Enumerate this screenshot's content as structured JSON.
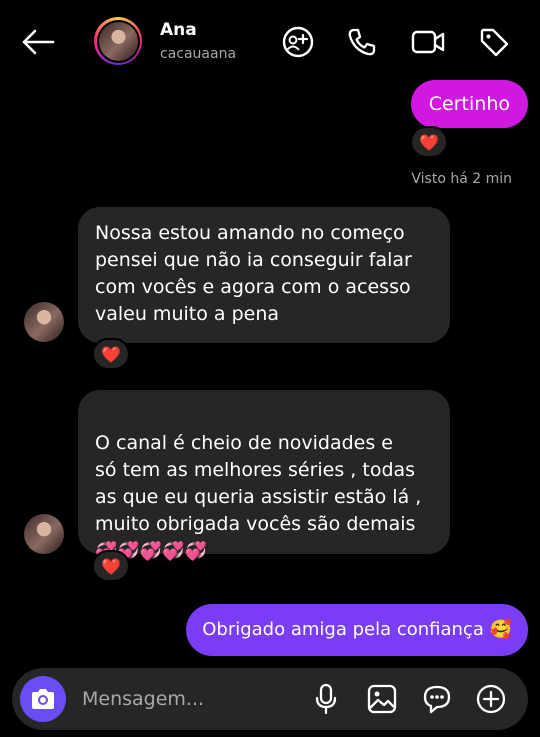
{
  "header": {
    "name": "Ana",
    "username": "cacauaana",
    "icons": [
      "back-arrow-icon",
      "add-people-icon",
      "phone-icon",
      "video-call-icon",
      "tag-icon"
    ]
  },
  "messages": [
    {
      "direction": "outgoing",
      "text": "Certinho",
      "reaction": "❤️"
    },
    {
      "direction": "incoming",
      "text": "Nossa estou amando no começo\npensei que não ia conseguir falar\ncom vocês e agora com o acesso\nvaleu muito a pena",
      "reaction": "❤️"
    },
    {
      "direction": "incoming",
      "text": "O canal é cheio de novidades e\nsó tem as melhores séries  , todas\nas que eu queria assistir estão lá ,\nmuito obrigada vocês são demais",
      "emoji_line": "💞💞💞💞💞",
      "reaction": "❤️"
    },
    {
      "direction": "outgoing",
      "text": "Obrigado amiga pela confiança 🥰"
    }
  ],
  "seen_label": "Visto há 2 min",
  "composer": {
    "placeholder": "Mensagem...",
    "icons": [
      "camera-icon",
      "microphone-icon",
      "gallery-icon",
      "sticker-icon",
      "plus-icon"
    ]
  },
  "colors": {
    "outgoing_pink": "#d118e0",
    "outgoing_purple": "#7a3df5",
    "incoming_bubble": "#262626",
    "camera_button": "#6b4cf5"
  }
}
